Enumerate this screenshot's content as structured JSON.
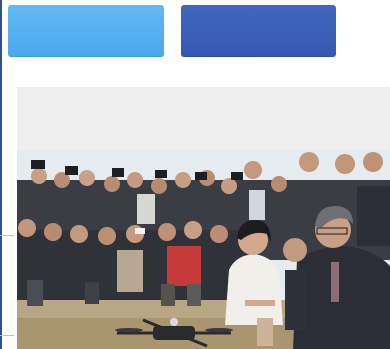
{
  "toolbar": {
    "primary_button_label": "",
    "secondary_button_label": ""
  },
  "colors": {
    "primary_button": "#4fadf0",
    "secondary_button": "#3a5cb6",
    "rule": "#2f4f8f",
    "placeholder": "#efefef"
  },
  "content": {
    "photo_subject": "press-photographers-crowd-drone"
  }
}
